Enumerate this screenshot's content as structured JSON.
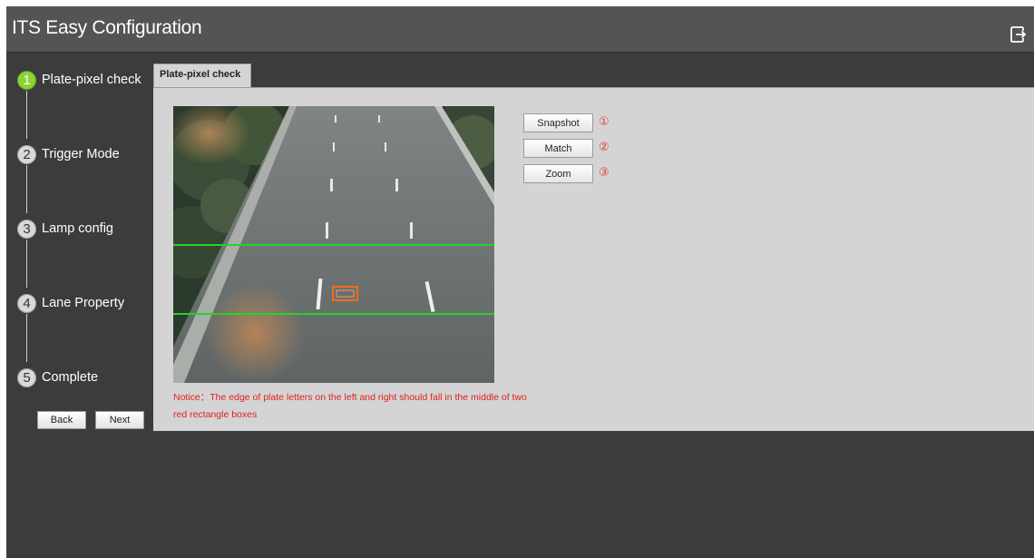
{
  "app": {
    "title": "ITS Easy Configuration",
    "exit_icon": "logout-icon"
  },
  "steps": [
    {
      "number": "1",
      "label": "Plate-pixel check",
      "active": true
    },
    {
      "number": "2",
      "label": "Trigger Mode",
      "active": false
    },
    {
      "number": "3",
      "label": "Lamp config",
      "active": false
    },
    {
      "number": "4",
      "label": "Lane Property",
      "active": false
    },
    {
      "number": "5",
      "label": "Complete",
      "active": false
    }
  ],
  "nav": {
    "back_label": "Back",
    "next_label": "Next"
  },
  "tab": {
    "label": "Plate-pixel check"
  },
  "actions": [
    {
      "label": "Snapshot",
      "marker": "①"
    },
    {
      "label": "Match",
      "marker": "②"
    },
    {
      "label": "Zoom",
      "marker": "③"
    }
  ],
  "notice": {
    "text": "Notice：The edge of plate letters on the left and right should fall in the middle of two red rectangle boxes"
  },
  "colors": {
    "accent_active_step": "#8bd336",
    "guide_line": "#22d622",
    "plate_box": "#ff6a1a",
    "notice_text": "#e02020"
  }
}
